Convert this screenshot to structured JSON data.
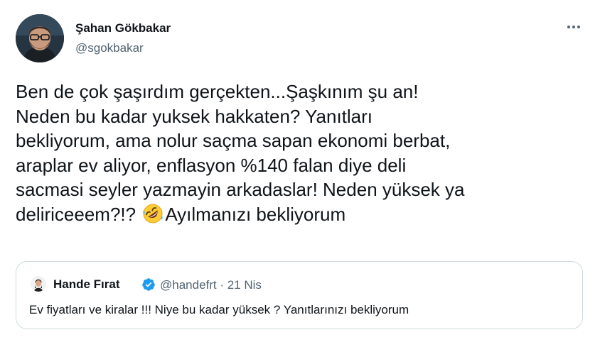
{
  "author": {
    "name": "Şahan Gökbakar",
    "handle": "@sgokbakar"
  },
  "tweet": {
    "line1": "Ben de çok şaşırdım gerçekten...Şaşkınım şu an!",
    "line2": "Neden bu kadar yuksek hakkaten? Yanıtları",
    "line3": "bekliyorum, ama nolur saçma sapan ekonomi berbat,",
    "line4": "araplar ev aliyor, enflasyon %140 falan diye deli",
    "line5": "sacmasi seyler yazmayin arkadaslar! Neden yüksek ya",
    "line6_start": "deliriceeem?!? ",
    "line6_end": "Ayılmanızı bekliyorum",
    "emoji_icon": "rolling-on-floor-laughing-emoji"
  },
  "menu_icon": "more-horizontal-icon",
  "quote": {
    "name": "Hande Fırat",
    "verified_icon": "verified-badge-icon",
    "handle_date": "@handefrt · 21 Nis",
    "text": "Ev fiyatları ve kiralar !!! Niye bu kadar yüksek ? Yanıtlarınızı bekliyorum"
  },
  "colors": {
    "text": "#0f1419",
    "secondary": "#536471",
    "verified": "#1d9bf0",
    "border": "#cfd9de"
  }
}
